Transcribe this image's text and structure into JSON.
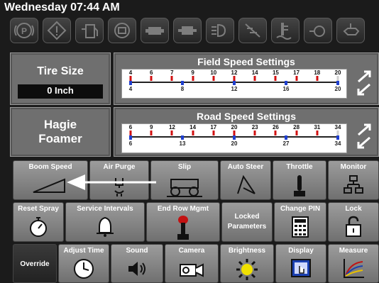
{
  "header": {
    "datetime": "Wednesday 07:44 AM"
  },
  "warning_icons": [
    "parking-brake-icon",
    "warning-diamond-icon",
    "fuel-alert-icon",
    "engine-alert-icon",
    "battery-alert-icon",
    "transmission-icon",
    "headlight-icon",
    "filter-alert-icon",
    "coolant-level-icon",
    "hydraulic-temp-icon",
    "oil-pressure-icon"
  ],
  "tire_size": {
    "label": "Tire Size",
    "value": "0 Inch"
  },
  "product": {
    "label_line1": "Hagie",
    "label_line2": "Foamer"
  },
  "field_speed": {
    "title": "Field Speed Settings",
    "top_ticks": [
      "4",
      "6",
      "7",
      "9",
      "10",
      "12",
      "14",
      "15",
      "17",
      "18",
      "20"
    ],
    "bottom_ticks": [
      "4",
      "8",
      "12",
      "16",
      "20"
    ]
  },
  "road_speed": {
    "title": "Road Speed Settings",
    "top_ticks": [
      "6",
      "9",
      "12",
      "14",
      "17",
      "20",
      "23",
      "26",
      "28",
      "31",
      "34"
    ],
    "bottom_ticks": [
      "6",
      "13",
      "20",
      "27",
      "34"
    ]
  },
  "buttons": {
    "boom_speed": "Boom Speed",
    "air_purge": "Air Purge",
    "slip": "Slip",
    "auto_steer": "Auto Steer",
    "throttle": "Throttle",
    "monitor": "Monitor",
    "reset_spray": "Reset Spray",
    "service_intervals": "Service Intervals",
    "end_row_mgmt": "End Row Mgmt",
    "locked_params_1": "Locked",
    "locked_params_2": "Parameters",
    "change_pin": "Change PIN",
    "lock": "Lock",
    "override": "Override",
    "adjust_time": "Adjust Time",
    "sound": "Sound",
    "camera": "Camera",
    "brightness": "Brightness",
    "display": "Display",
    "measure": "Measure"
  }
}
